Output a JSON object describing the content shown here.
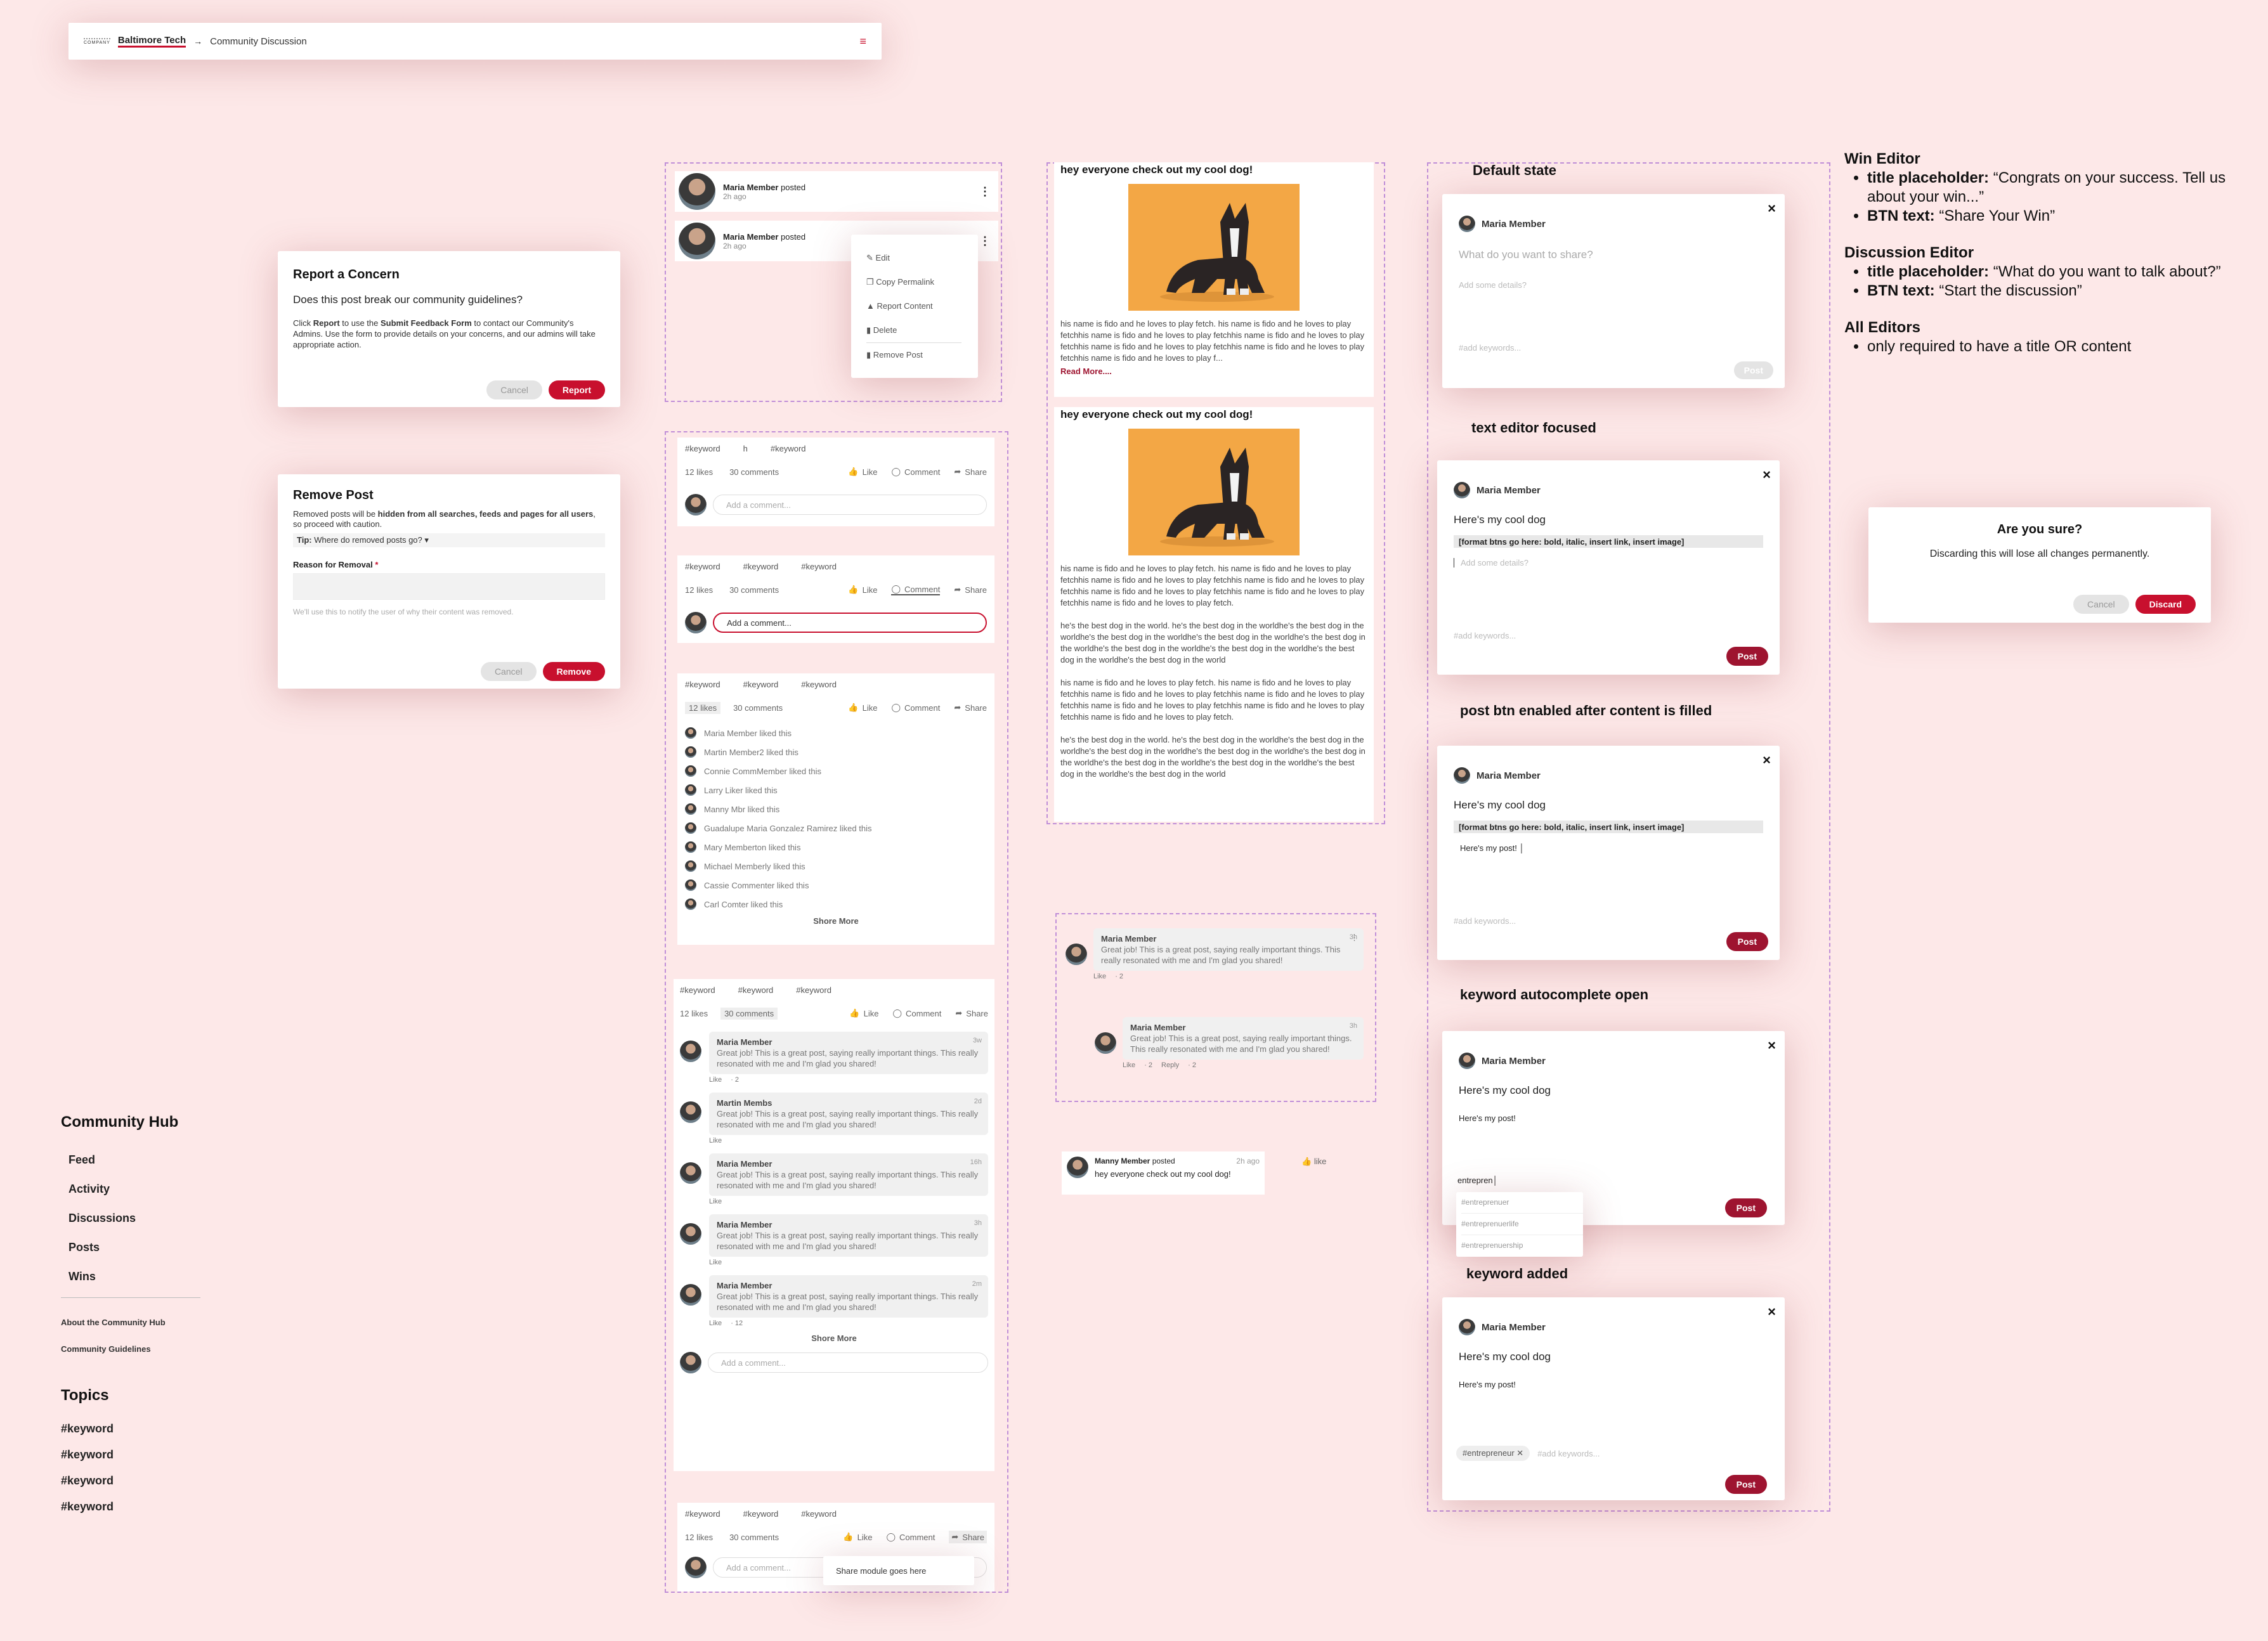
{
  "topbar": {
    "brand_small": "COMPANY",
    "brand": "Baltimore Tech",
    "arrow": "→",
    "page": "Community Discussion",
    "menu_icon": "≡"
  },
  "report": {
    "title": "Report a Concern",
    "question": "Does this post break our community guidelines?",
    "body1": "Click ",
    "b1": "Report",
    "body2": " to use the ",
    "b2": "Submit Feedback Form",
    "body3": " to contact our Community's Admins. Use the form to provide details on your concerns, and our admins will take appropriate action.",
    "cancel": "Cancel",
    "action": "Report"
  },
  "remove": {
    "title": "Remove Post",
    "body1": "Removed posts will be ",
    "b1": "hidden from all searches, feeds and pages for all users",
    "body2": ", so proceed with caution.",
    "tip_label": "Tip:",
    "tip": "Where do removed posts go?",
    "reason_label": "Reason for Removal",
    "req": "*",
    "helper": "We'll use this to notify the user of why their content was removed.",
    "cancel": "Cancel",
    "action": "Remove"
  },
  "sidebar": {
    "hub_title": "Community Hub",
    "items": [
      "Feed",
      "Activity",
      "Discussions",
      "Posts",
      "Wins"
    ],
    "links": [
      "About the Community Hub",
      "Community Guidelines"
    ],
    "topics_title": "Topics",
    "topics": [
      "#keyword",
      "#keyword",
      "#keyword",
      "#keyword"
    ]
  },
  "post_menu": {
    "author": "Maria Member",
    "verb": "posted",
    "time": "2h ago",
    "items": [
      "Edit",
      "Copy Permalink",
      "Report Content",
      "Delete",
      "Remove Post"
    ]
  },
  "social": {
    "keyword": "#keyword",
    "h": "h",
    "likes": "12 likes",
    "comments": "30 comments",
    "like": "Like",
    "comment": "Comment",
    "share": "Share",
    "add_comment": "Add a comment...",
    "show_more": "Shore More",
    "share_module": "Share module goes here"
  },
  "likers": [
    "Maria Member liked this",
    "Martin Member2 liked this",
    "Connie CommMember liked this",
    "Larry Liker liked this",
    "Manny Mbr liked this",
    "Guadalupe Maria Gonzalez Ramirez liked this",
    "Mary Memberton liked this",
    "Michael Memberly liked this",
    "Cassie Commenter liked this",
    "Carl Comter liked this"
  ],
  "comment_text": "Great job! This is a great post, saying really important things. This really resonated with me and I'm glad you shared!",
  "comments": [
    {
      "name": "Maria Member",
      "time": "3w",
      "actions": [
        "Like",
        "· 2"
      ]
    },
    {
      "name": "Martin Membs",
      "time": "2d",
      "actions": [
        "Like"
      ]
    },
    {
      "name": "Maria Member",
      "time": "16h",
      "actions": [
        "Like"
      ]
    },
    {
      "name": "Maria Member",
      "time": "3h",
      "actions": [
        "Like"
      ]
    },
    {
      "name": "Maria Member",
      "time": "2m",
      "actions": [
        "Like",
        "· 12"
      ]
    }
  ],
  "thread": [
    {
      "name": "Maria Member",
      "time": "3h",
      "actions": [
        "Like",
        "· 2"
      ]
    },
    {
      "name": "Maria Member",
      "time": "3h",
      "actions": [
        "Like",
        "· 2",
        "Reply",
        "· 2"
      ]
    }
  ],
  "mini_post": {
    "author": "Manny Member",
    "verb": "posted",
    "time": "2h ago",
    "text": "hey everyone check out my cool dog!",
    "like": "like"
  },
  "dogpost": {
    "title": "hey everyone check out my cool dog!",
    "short": "his name is fido and he loves to play fetch. his name is fido and he loves to play fetchhis name is fido and he loves to play fetchhis name is fido and he loves to play fetchhis name is fido and he loves to play fetchhis name is fido and he loves to play fetchhis name is fido and he loves to play f...",
    "read_more": "Read More....",
    "p1": "his name is fido and he loves to play fetch. his name is fido and he loves to play fetchhis name is fido and he loves to play fetchhis name is fido and he loves to play fetchhis name is fido and he loves to play fetchhis name is fido and he loves to play fetchhis name is fido and he loves to play fetch.",
    "p2": "he's the best dog in the world. he's the best dog in the worldhe's the best dog in the worldhe's the best dog in the worldhe's the best dog in the worldhe's the best dog in the worldhe's the best dog in the worldhe's the best dog in the worldhe's the best dog in the worldhe's the best dog in the world"
  },
  "editors": {
    "labels": [
      "Default state",
      "text editor focused",
      "post btn enabled after content is filled",
      "keyword autocomplete open",
      "keyword added"
    ],
    "author": "Maria Member",
    "title_ph": "What do you want to share?",
    "details_ph": "Add some details?",
    "keywords_ph": "#add keywords...",
    "title_val": "Here's my cool dog",
    "fmt": "[format btns go here: bold, italic, insert link, insert image]",
    "body_val": "Here's my post!",
    "typing": "entrepren",
    "suggestions": [
      "#entreprenuer",
      "#entreprenuerlife",
      "#entreprenuership"
    ],
    "chip": "#entrepreneur",
    "post": "Post",
    "close": "×"
  },
  "notes": {
    "win_title": "Win Editor",
    "tp": "title placeholder:",
    "win_tp": "“Congrats on your success. Tell us about your win...”",
    "bt": "BTN text:",
    "win_bt": "“Share Your Win”",
    "disc_title": "Discussion Editor",
    "disc_tp": "“What do you want to talk about?”",
    "disc_bt": "“Start the discussion”",
    "all_title": "All Editors",
    "all_note": "only required to have a title OR content"
  },
  "confirm": {
    "title": "Are you sure?",
    "body": "Discarding this will lose all changes permanently.",
    "cancel": "Cancel",
    "action": "Discard"
  },
  "colors": {
    "bg": "#fde8e8",
    "accent": "#c8102e",
    "dark_accent": "#9e1430",
    "dog_bg": "#f3a745"
  }
}
